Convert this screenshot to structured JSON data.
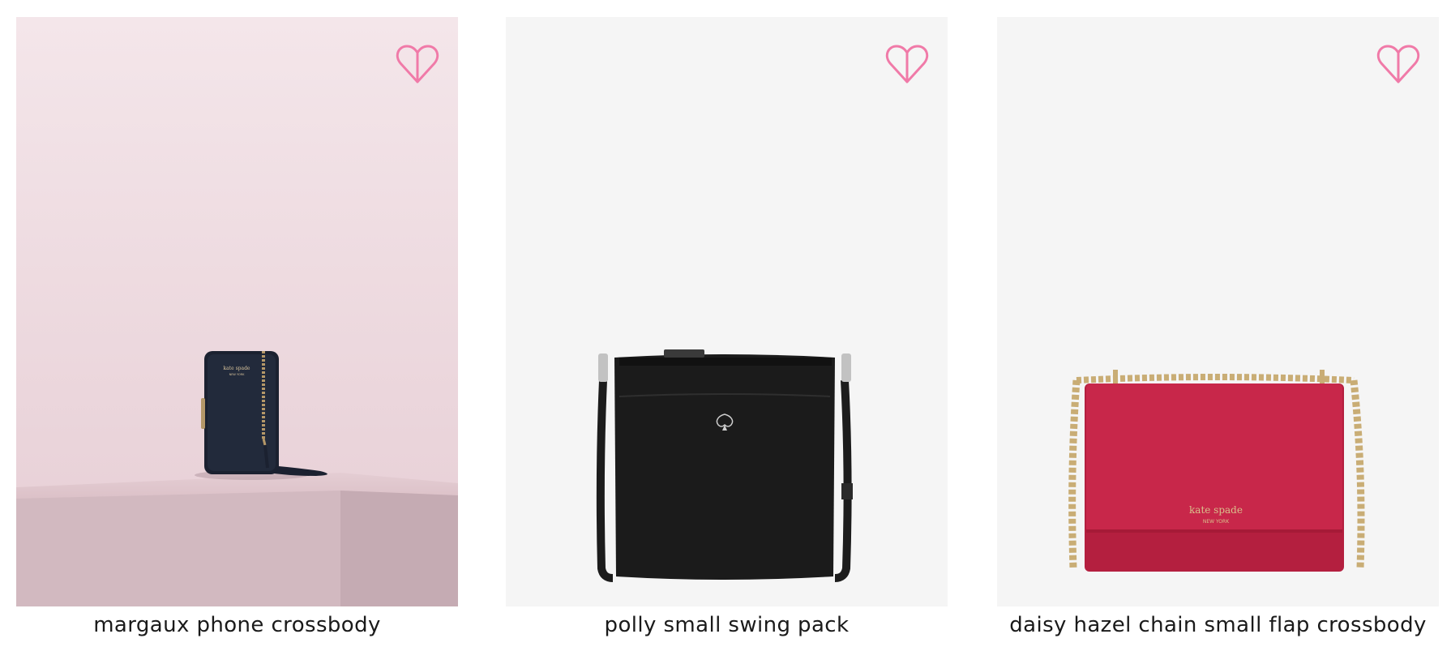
{
  "products": [
    {
      "name": "margaux phone crossbody",
      "favorite_icon": "heart-outline-icon",
      "image_subject": "black phone crossbody on pink pedestal",
      "colors": {
        "background": "#ecd7dd",
        "product": "#1b2130",
        "hardware": "#b49768"
      },
      "logo_text": [
        "kate spade",
        "new york"
      ]
    },
    {
      "name": "polly small swing pack",
      "favorite_icon": "heart-outline-icon",
      "image_subject": "black pebbled leather swing pack",
      "colors": {
        "background": "#f5f5f5",
        "product": "#1b1b1b",
        "hardware": "#c2c2c2"
      }
    },
    {
      "name": "daisy hazel chain small flap crossbody",
      "favorite_icon": "heart-outline-icon",
      "image_subject": "raspberry red flap crossbody with gold chain",
      "colors": {
        "background": "#f5f5f5",
        "product": "#c8274a",
        "hardware": "#c9ad75"
      },
      "logo_text": [
        "kate spade",
        "NEW YORK"
      ]
    }
  ],
  "theme": {
    "heart_color": "#f07aa8"
  }
}
